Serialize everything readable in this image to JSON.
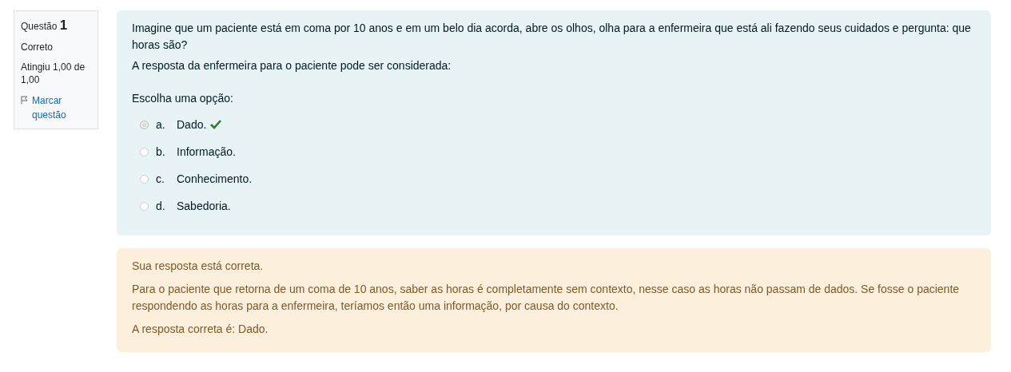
{
  "info": {
    "label": "Questão",
    "number": "1",
    "state": "Correto",
    "grade": "Atingiu 1,00 de 1,00",
    "flag": "Marcar questão"
  },
  "question": {
    "text": "Imagine que um paciente está em coma por 10 anos e em um belo dia acorda, abre os olhos, olha para a enfermeira que está ali fazendo seus cuidados e pergunta: que horas são?",
    "subtext": "A resposta da enfermeira para o paciente pode ser considerada:",
    "prompt": "Escolha uma opção:",
    "options": [
      {
        "letter": "a.",
        "text": "Dado.",
        "selected": true,
        "correct": true
      },
      {
        "letter": "b.",
        "text": "Informação.",
        "selected": false,
        "correct": false
      },
      {
        "letter": "c.",
        "text": "Conhecimento.",
        "selected": false,
        "correct": false
      },
      {
        "letter": "d.",
        "text": "Sabedoria.",
        "selected": false,
        "correct": false
      }
    ]
  },
  "feedback": {
    "status": "Sua resposta está correta.",
    "explanation": "Para o paciente que retorna de um coma de 10 anos, saber as horas é completamente sem contexto, nesse caso as horas não passam de dados. Se fosse o paciente respondendo as horas para a enfermeira, teríamos então uma informação, por causa do contexto.",
    "answer": "A resposta correta é: Dado."
  }
}
